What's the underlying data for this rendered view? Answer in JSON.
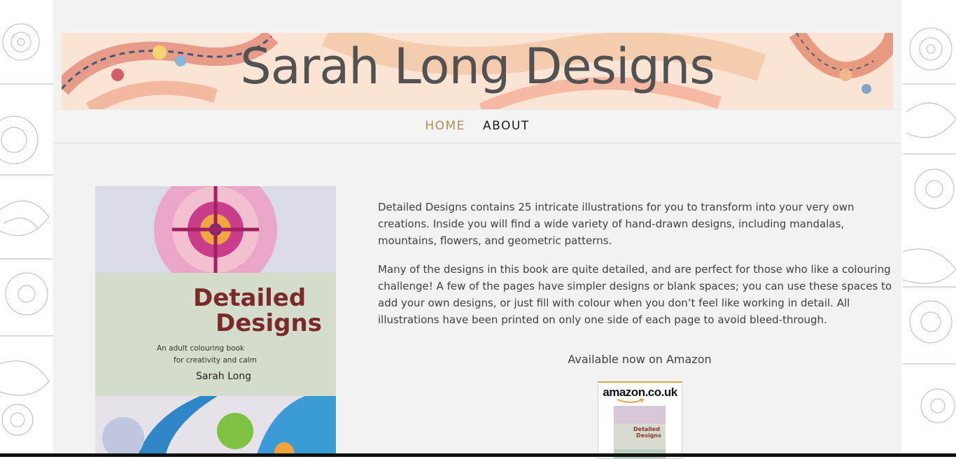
{
  "site": {
    "title": "Sarah Long Designs"
  },
  "nav": {
    "items": [
      {
        "label": "HOME",
        "active": true
      },
      {
        "label": "ABOUT",
        "active": false
      }
    ]
  },
  "book": {
    "title_line1": "Detailed",
    "title_line2": "Designs",
    "subtitle_line1": "An adult colouring book",
    "subtitle_line2": "for creativity and calm",
    "author": "Sarah Long"
  },
  "content": {
    "paragraphs": [
      "Detailed Designs contains 25 intricate illustrations for you to transform into your very own creations. Inside you will find a wide variety of hand-drawn designs, including mandalas, mountains, flowers, and geometric patterns.",
      "Many of the designs in this book are quite detailed, and are perfect for those who like a colouring challenge! A few of the pages have simpler designs or blank spaces; you can use these spaces to add your own designs, or just fill with colour when you don’t feel like working in detail.  All illustrations have been printed on only one side of each page to avoid bleed-through."
    ],
    "available_text": "Available now on Amazon"
  },
  "amazon": {
    "logo_text": "amazon.co.uk",
    "thumb_title1": "Detailed",
    "thumb_title2": "Designs"
  },
  "colors": {
    "nav_active": "#b08d4f",
    "title": "#525252",
    "body_text": "#404040"
  }
}
